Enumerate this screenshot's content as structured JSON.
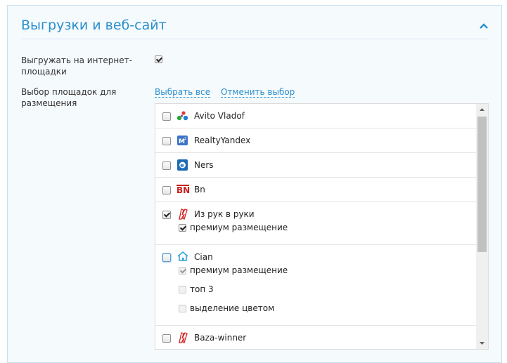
{
  "section": {
    "title": "Выгрузки и веб-сайт",
    "export_label": "Выгружать на интернет-площадки",
    "export_checked": true,
    "platforms_label": "Выбор площадок для размещения",
    "select_all": "Выбрать все",
    "deselect": "Отменить выбор"
  },
  "colors": {
    "accent": "#2a8fcd",
    "panel_bg": "#f5fafd",
    "panel_border": "#c7dfee"
  },
  "platforms": [
    {
      "name": "Avito Vladof",
      "icon": "avito-logo-icon",
      "checked": false
    },
    {
      "name": "RealtyYandex",
      "icon": "realty-yandex-logo-icon",
      "checked": false
    },
    {
      "name": "Ners",
      "icon": "ners-logo-icon",
      "checked": false
    },
    {
      "name": "Bn",
      "icon": "bn-logo-icon",
      "checked": false
    },
    {
      "name": "Из рук в руки",
      "icon": "irr-logo-icon",
      "checked": true,
      "options": [
        {
          "label": "премиум размещение",
          "checked": true,
          "disabled": false
        }
      ]
    },
    {
      "name": "Cian",
      "icon": "cian-house-icon",
      "checked": false,
      "options": [
        {
          "label": "премиум размещение",
          "checked": true,
          "disabled": true
        },
        {
          "label": "топ 3",
          "checked": false,
          "disabled": true
        },
        {
          "label": "выделение цветом",
          "checked": false,
          "disabled": true
        }
      ]
    },
    {
      "name": "Baza-winner",
      "icon": "baza-winner-logo-icon",
      "checked": false
    }
  ]
}
